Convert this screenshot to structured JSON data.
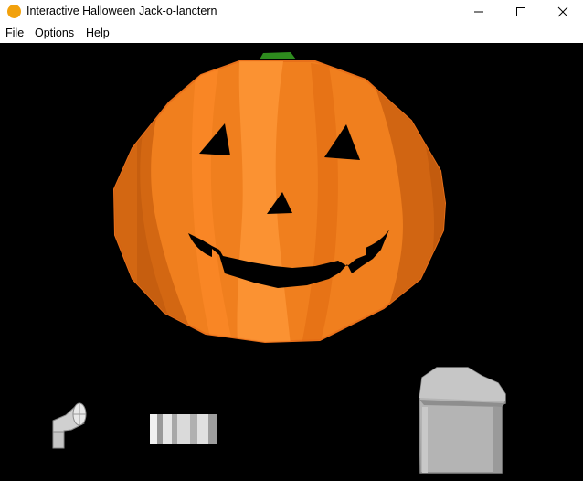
{
  "window": {
    "title": "Interactive Halloween Jack-o-lanctern",
    "icon": "orange-circle-icon",
    "controls": {
      "minimize_icon": "minimize-icon",
      "maximize_icon": "maximize-icon",
      "close_icon": "close-icon"
    }
  },
  "menu": {
    "items": [
      {
        "label": "File"
      },
      {
        "label": "Options"
      },
      {
        "label": "Help"
      }
    ]
  },
  "scene": {
    "background": "#000000",
    "objects": [
      {
        "name": "jack-o-lantern",
        "icon": "pumpkin-icon"
      },
      {
        "name": "flashlight",
        "icon": "flashlight-icon"
      },
      {
        "name": "tin-can",
        "icon": "can-icon"
      },
      {
        "name": "tombstone",
        "icon": "tombstone-icon"
      }
    ]
  },
  "colors": {
    "pumpkin_base": "#f07f1e",
    "pumpkin_dark": "#c95f0f",
    "pumpkin_light": "#ff9a3a",
    "stem": "#2e8b1e",
    "app_icon": "#f2a10c",
    "metal": "#b8b8b8",
    "stone": "#b4b4b4"
  }
}
